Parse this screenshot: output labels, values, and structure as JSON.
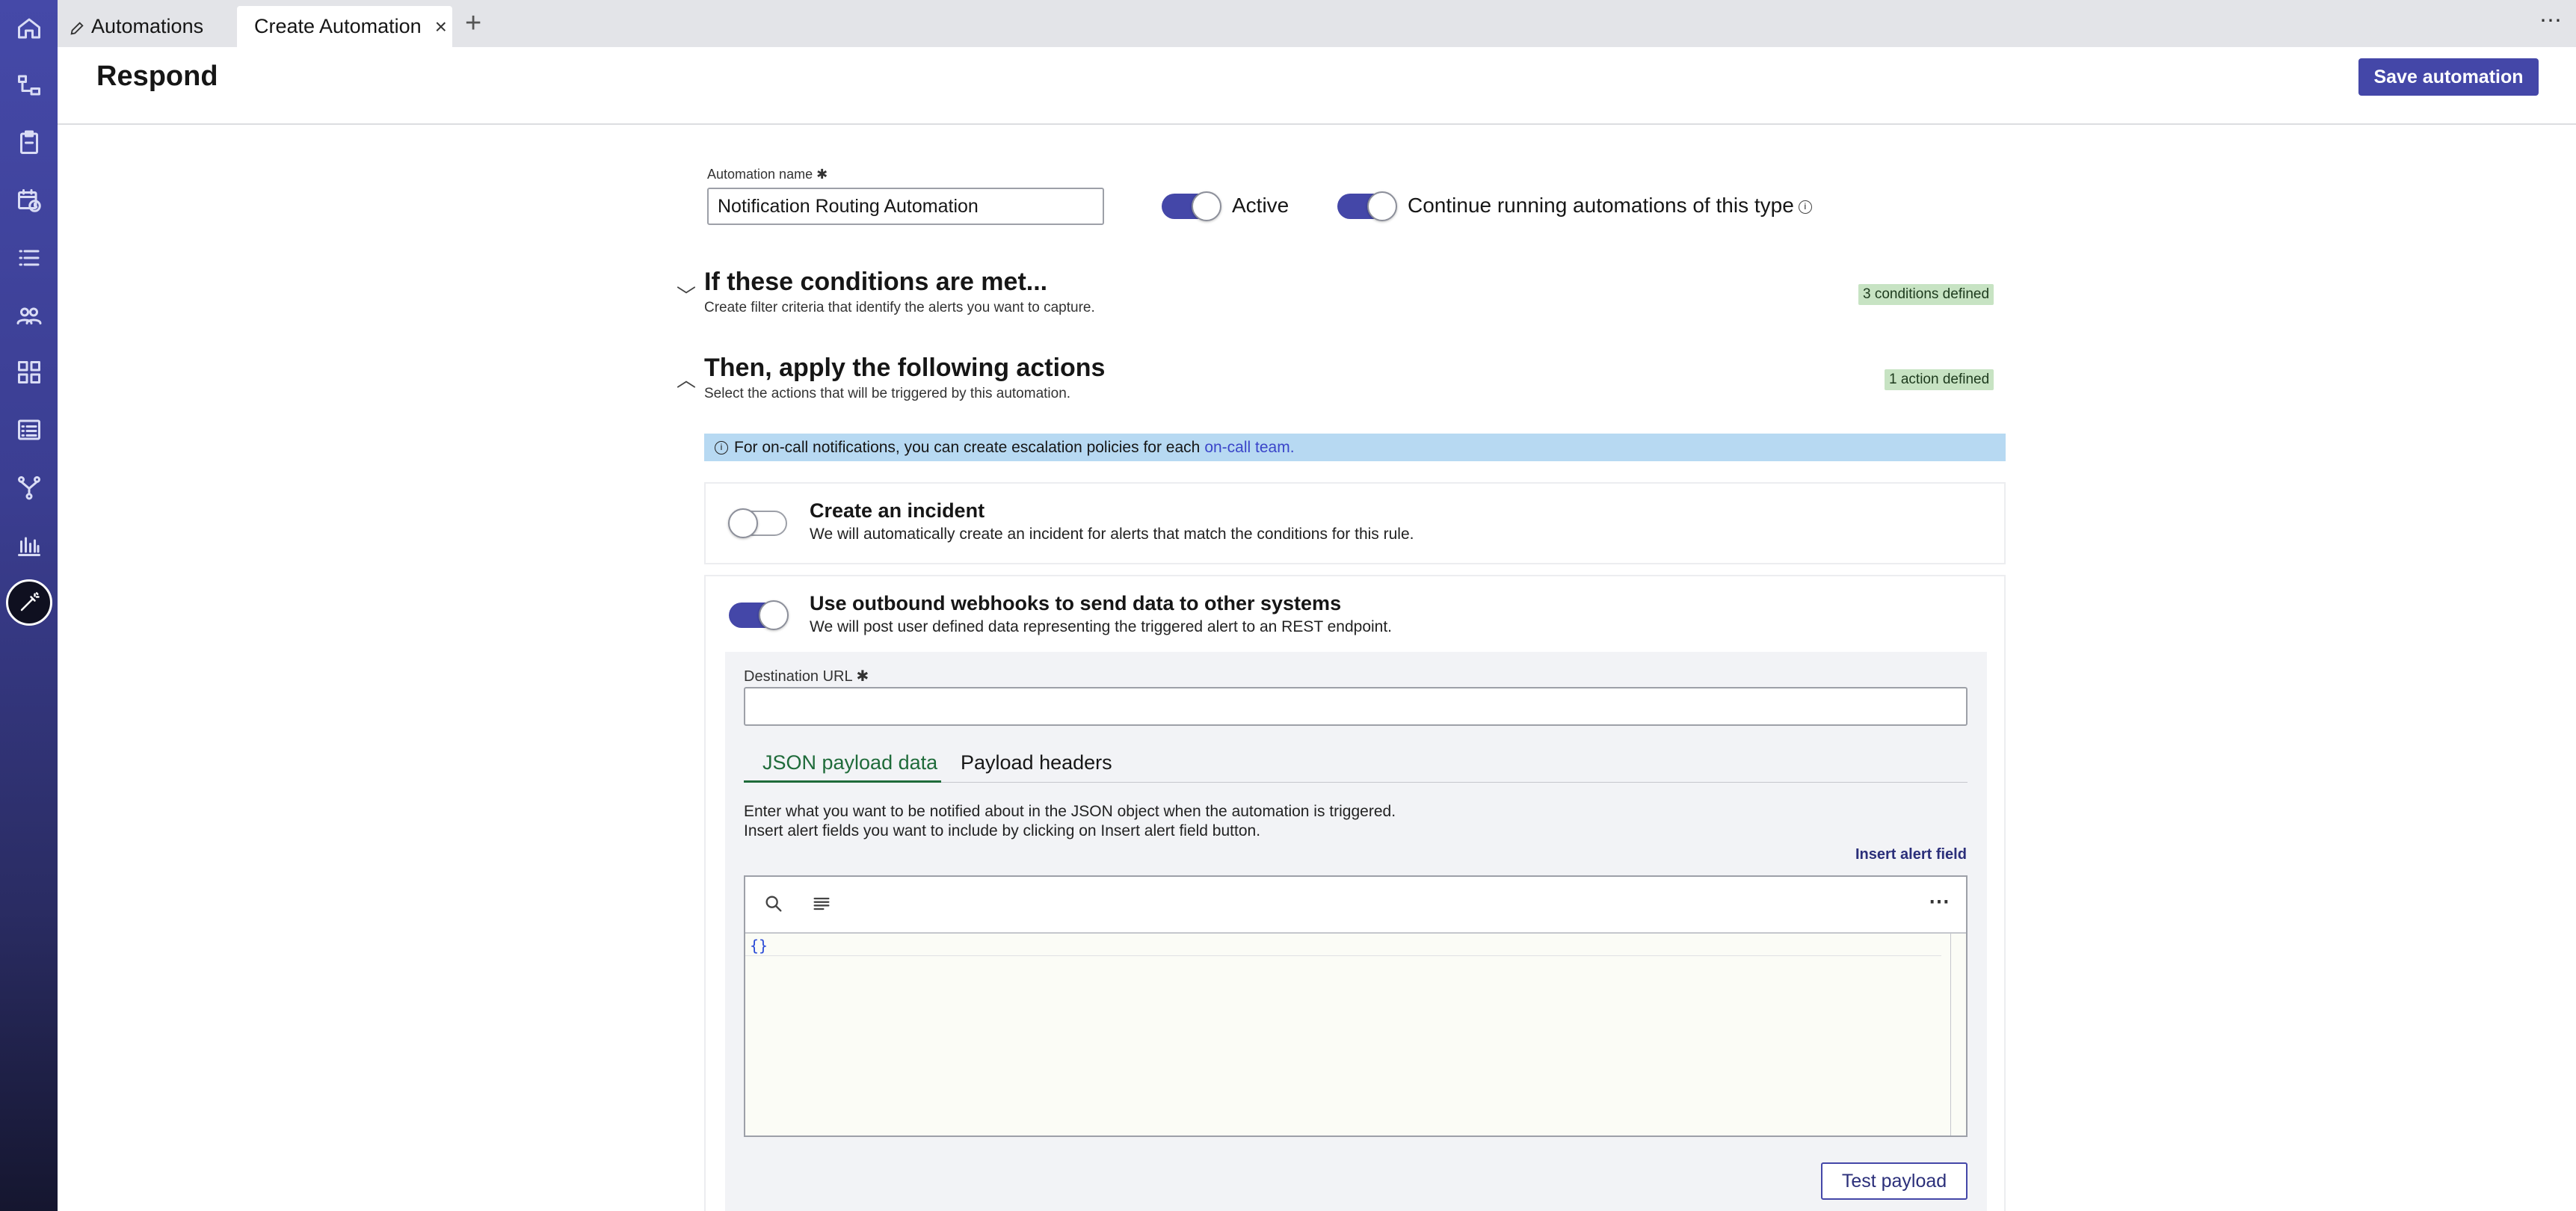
{
  "tabs": [
    {
      "label": "Automations"
    },
    {
      "label": "Create Automation"
    }
  ],
  "tab_add": "+",
  "tab_close": "×",
  "tab_more": "⋯",
  "header": {
    "title": "Respond",
    "save_label": "Save automation"
  },
  "form": {
    "name_label": "Automation name ✱",
    "name_value": "Notification Routing Automation",
    "active_label": "Active",
    "active_on": true,
    "continue_label": "Continue running automations of this type",
    "continue_on": true
  },
  "conditions": {
    "title": "If these conditions are met...",
    "subtitle": "Create filter criteria that identify the alerts you want to capture.",
    "badge": "3 conditions defined"
  },
  "actions": {
    "title": "Then, apply the following actions",
    "subtitle": "Select the actions that will be triggered by this automation.",
    "badge": "1 action defined",
    "banner_text": "For on-call notifications, you can create escalation policies for each",
    "banner_link": "on-call team.",
    "incident": {
      "title": "Create an incident",
      "subtitle": "We will automatically create an incident for alerts that match the conditions for this rule.",
      "on": false
    },
    "webhook": {
      "title": "Use outbound webhooks to send data to other systems",
      "subtitle": "We will post user defined data representing the triggered alert to an REST endpoint.",
      "on": true,
      "url_label": "Destination URL ✱",
      "url_value": "",
      "tabs": [
        "JSON payload data",
        "Payload headers"
      ],
      "desc_line1": "Enter what you want to be notified about in the JSON object when the automation is triggered.",
      "desc_line2": "Insert alert fields you want to include by clicking on Insert alert field button.",
      "insert_label": "Insert alert field",
      "editor_content": "{}",
      "editor_more": "⋯",
      "test_label": "Test payload"
    }
  },
  "colors": {
    "accent": "#4447a8",
    "badge_bg": "#c7e3c3",
    "banner_bg": "#b7d9f2",
    "active_tab": "#1f6b3a"
  },
  "sidebar_icons": [
    "home-icon",
    "workflow-icon",
    "clipboard-icon",
    "calendar-clock-icon",
    "list-icon",
    "team-icon",
    "grid-icon",
    "table-list-icon",
    "branch-icon",
    "bar-chart-icon",
    "automation-wand-icon"
  ]
}
